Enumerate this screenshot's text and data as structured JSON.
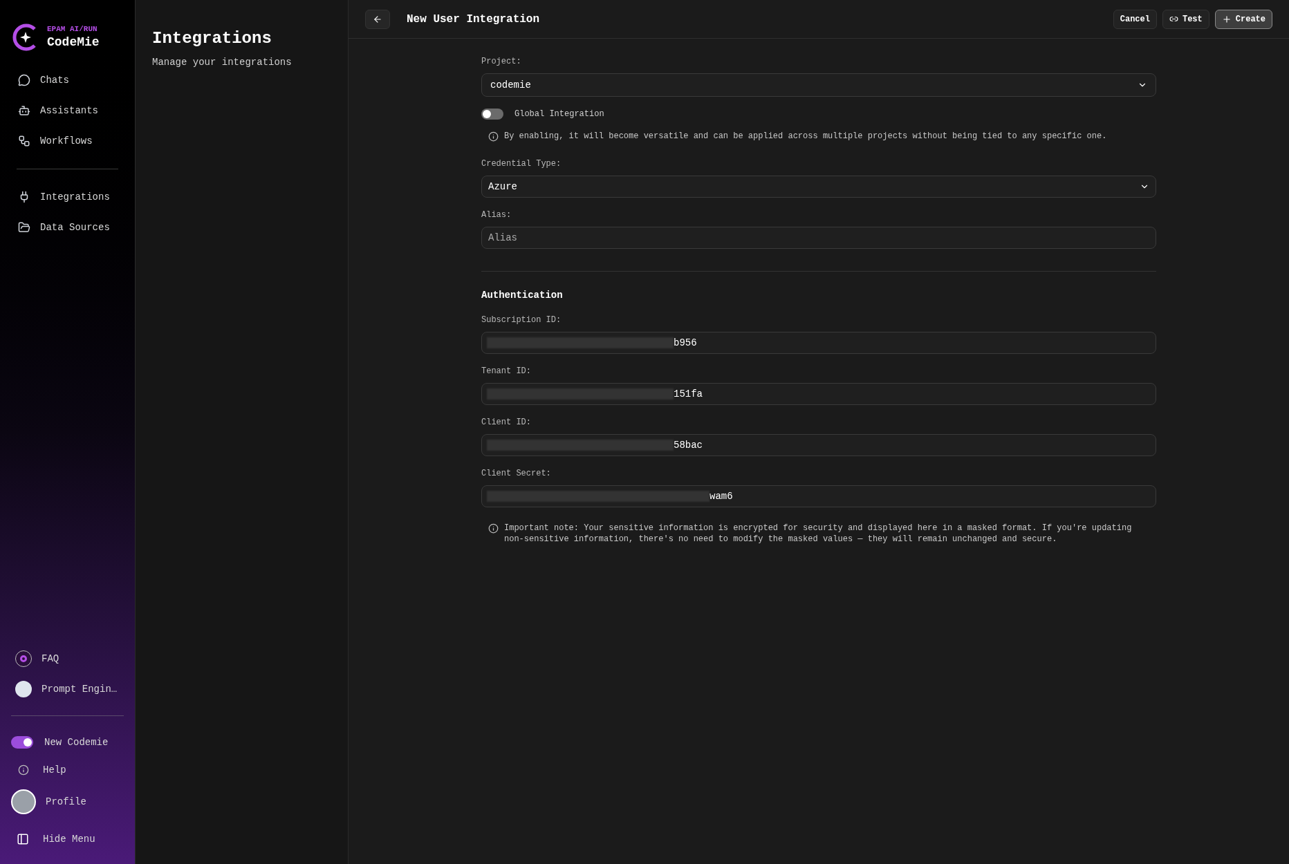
{
  "brand": {
    "eyebrow": "EPAM AI/RUN",
    "name": "CodeMie"
  },
  "nav_items": [
    {
      "label": "Chats",
      "kind": "chats"
    },
    {
      "label": "Assistants",
      "kind": "assistants"
    },
    {
      "label": "Workflows",
      "kind": "workflows"
    }
  ],
  "nav_items_2": [
    {
      "label": "Integrations",
      "kind": "integrations"
    },
    {
      "label": "Data Sources",
      "kind": "datasources"
    }
  ],
  "bottom_links": [
    {
      "label": "FAQ",
      "kind": "faq"
    },
    {
      "label": "Prompt Engin…",
      "kind": "prompt"
    }
  ],
  "new_codemie": {
    "label": "New Codemie",
    "on": true
  },
  "help": {
    "label": "Help"
  },
  "profile": {
    "label": "Profile"
  },
  "hide_menu": {
    "label": "Hide Menu"
  },
  "section": {
    "title": "Integrations",
    "subtitle": "Manage your integrations"
  },
  "header": {
    "title": "New User Integration",
    "buttons": [
      {
        "label": "Cancel",
        "kind": "cancel"
      },
      {
        "label": "Test",
        "kind": "test"
      },
      {
        "label": "Create",
        "kind": "create"
      }
    ]
  },
  "project": {
    "label": "Project:",
    "value": "codemie"
  },
  "global_integration": {
    "label": "Global Integration",
    "on": false,
    "note": "By enabling, it will become versatile and can be applied across multiple projects without being tied to any specific one."
  },
  "credential_type": {
    "label": "Credential Type:",
    "value": "Azure"
  },
  "alias": {
    "label": "Alias:",
    "placeholder": "Alias"
  },
  "authentication": {
    "title": "Authentication",
    "fields": [
      {
        "label": "Subscription ID:",
        "value": "b956",
        "masked": true
      },
      {
        "label": "Tenant ID:",
        "value": "151fa",
        "masked": true
      },
      {
        "label": "Client ID:",
        "value": "58bac",
        "masked": true
      },
      {
        "label": "Client Secret:",
        "value": "wam6",
        "masked": true
      }
    ],
    "note": "Important note: Your sensitive information is encrypted for security and displayed here in a masked format. If you're updating non-sensitive information, there's no need to modify the masked values — they will remain unchanged and secure."
  }
}
